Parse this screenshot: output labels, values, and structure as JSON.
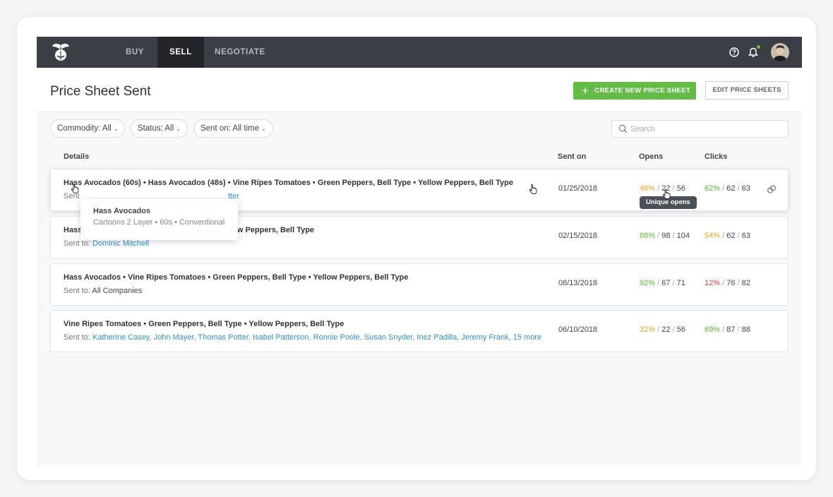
{
  "nav": {
    "links": [
      "BUY",
      "SELL",
      "NEGOTIATE"
    ],
    "active": "SELL",
    "icons": [
      "leaf-logo",
      "help-icon",
      "bell-icon",
      "avatar"
    ]
  },
  "header": {
    "title": "Price Sheet Sent",
    "create_button": "CREATE NEW PRICE SHEET",
    "edit_button": "EDIT PRICE SHEETS"
  },
  "filters": [
    {
      "label": "Commodity:",
      "value": "All"
    },
    {
      "label": "Status:",
      "value": "All"
    },
    {
      "label": "Sent on:",
      "value": "All time"
    }
  ],
  "search": {
    "placeholder": "Search"
  },
  "table": {
    "headers": [
      "Details",
      "Sent on",
      "Opens",
      "Clicks"
    ],
    "rows": [
      {
        "details": "Hass Avocados (60s) • Hass Avocados (48s) • Vine Ripes Tomatoes • Green Peppers, Bell Type • Yellow Peppers, Bell Type",
        "sent_prefix": "Sent",
        "sent_to": "tter",
        "date": "01/25/2018",
        "opens": {
          "pct": "46%",
          "a": "22",
          "b": "56"
        },
        "clicks": {
          "pct": "62%",
          "a": "62",
          "b": "63"
        }
      },
      {
        "details_prefix": "Hass",
        "details_suffix": "llow Peppers, Bell Type",
        "sent_prefix": "Sent to:",
        "sent_to": "Dominic Mitchell",
        "date": "02/15/2018",
        "opens": {
          "pct": "88%",
          "a": "98",
          "b": "104"
        },
        "clicks": {
          "pct": "54%",
          "a": "62",
          "b": "63"
        }
      },
      {
        "details": "Hass Avocados • Vine Ripes Tomatoes • Green Peppers, Bell Type • Yellow Peppers, Bell Type",
        "sent_prefix": "Sent to:",
        "sent_to": "All Companies",
        "date": "08/13/2018",
        "opens": {
          "pct": "92%",
          "a": "67",
          "b": "71"
        },
        "clicks": {
          "pct": "12%",
          "a": "76",
          "b": "82"
        }
      },
      {
        "details": "Vine Ripes Tomatoes • Green Peppers, Bell Type • Yellow Peppers, Bell Type",
        "sent_prefix": "Sent to:",
        "sent_to": "Katherine Casey, John Mayer, Thomas Potter, Isabel Patterson, Ronnie Poole, Susan Snyder, Inez Padilla, Jeremy Frank,",
        "sent_more": "15 more",
        "date": "06/10/2018",
        "opens": {
          "pct": "32%",
          "a": "22",
          "b": "56"
        },
        "clicks": {
          "pct": "69%",
          "a": "87",
          "b": "88"
        }
      }
    ]
  },
  "tooltip": "Unique opens",
  "popover": {
    "title": "Hass Avocados",
    "subtitle": "Cartoons 2 Layer • 60s • Conventional"
  },
  "colors": {
    "nav_bg": "#3b3e44",
    "nav_active": "#23252a",
    "primary_green": "#64bc47",
    "link_blue": "#2f8fd8",
    "pct_orange": "#f0a21a",
    "pct_green": "#5cb63a",
    "pct_red": "#e0442c"
  }
}
